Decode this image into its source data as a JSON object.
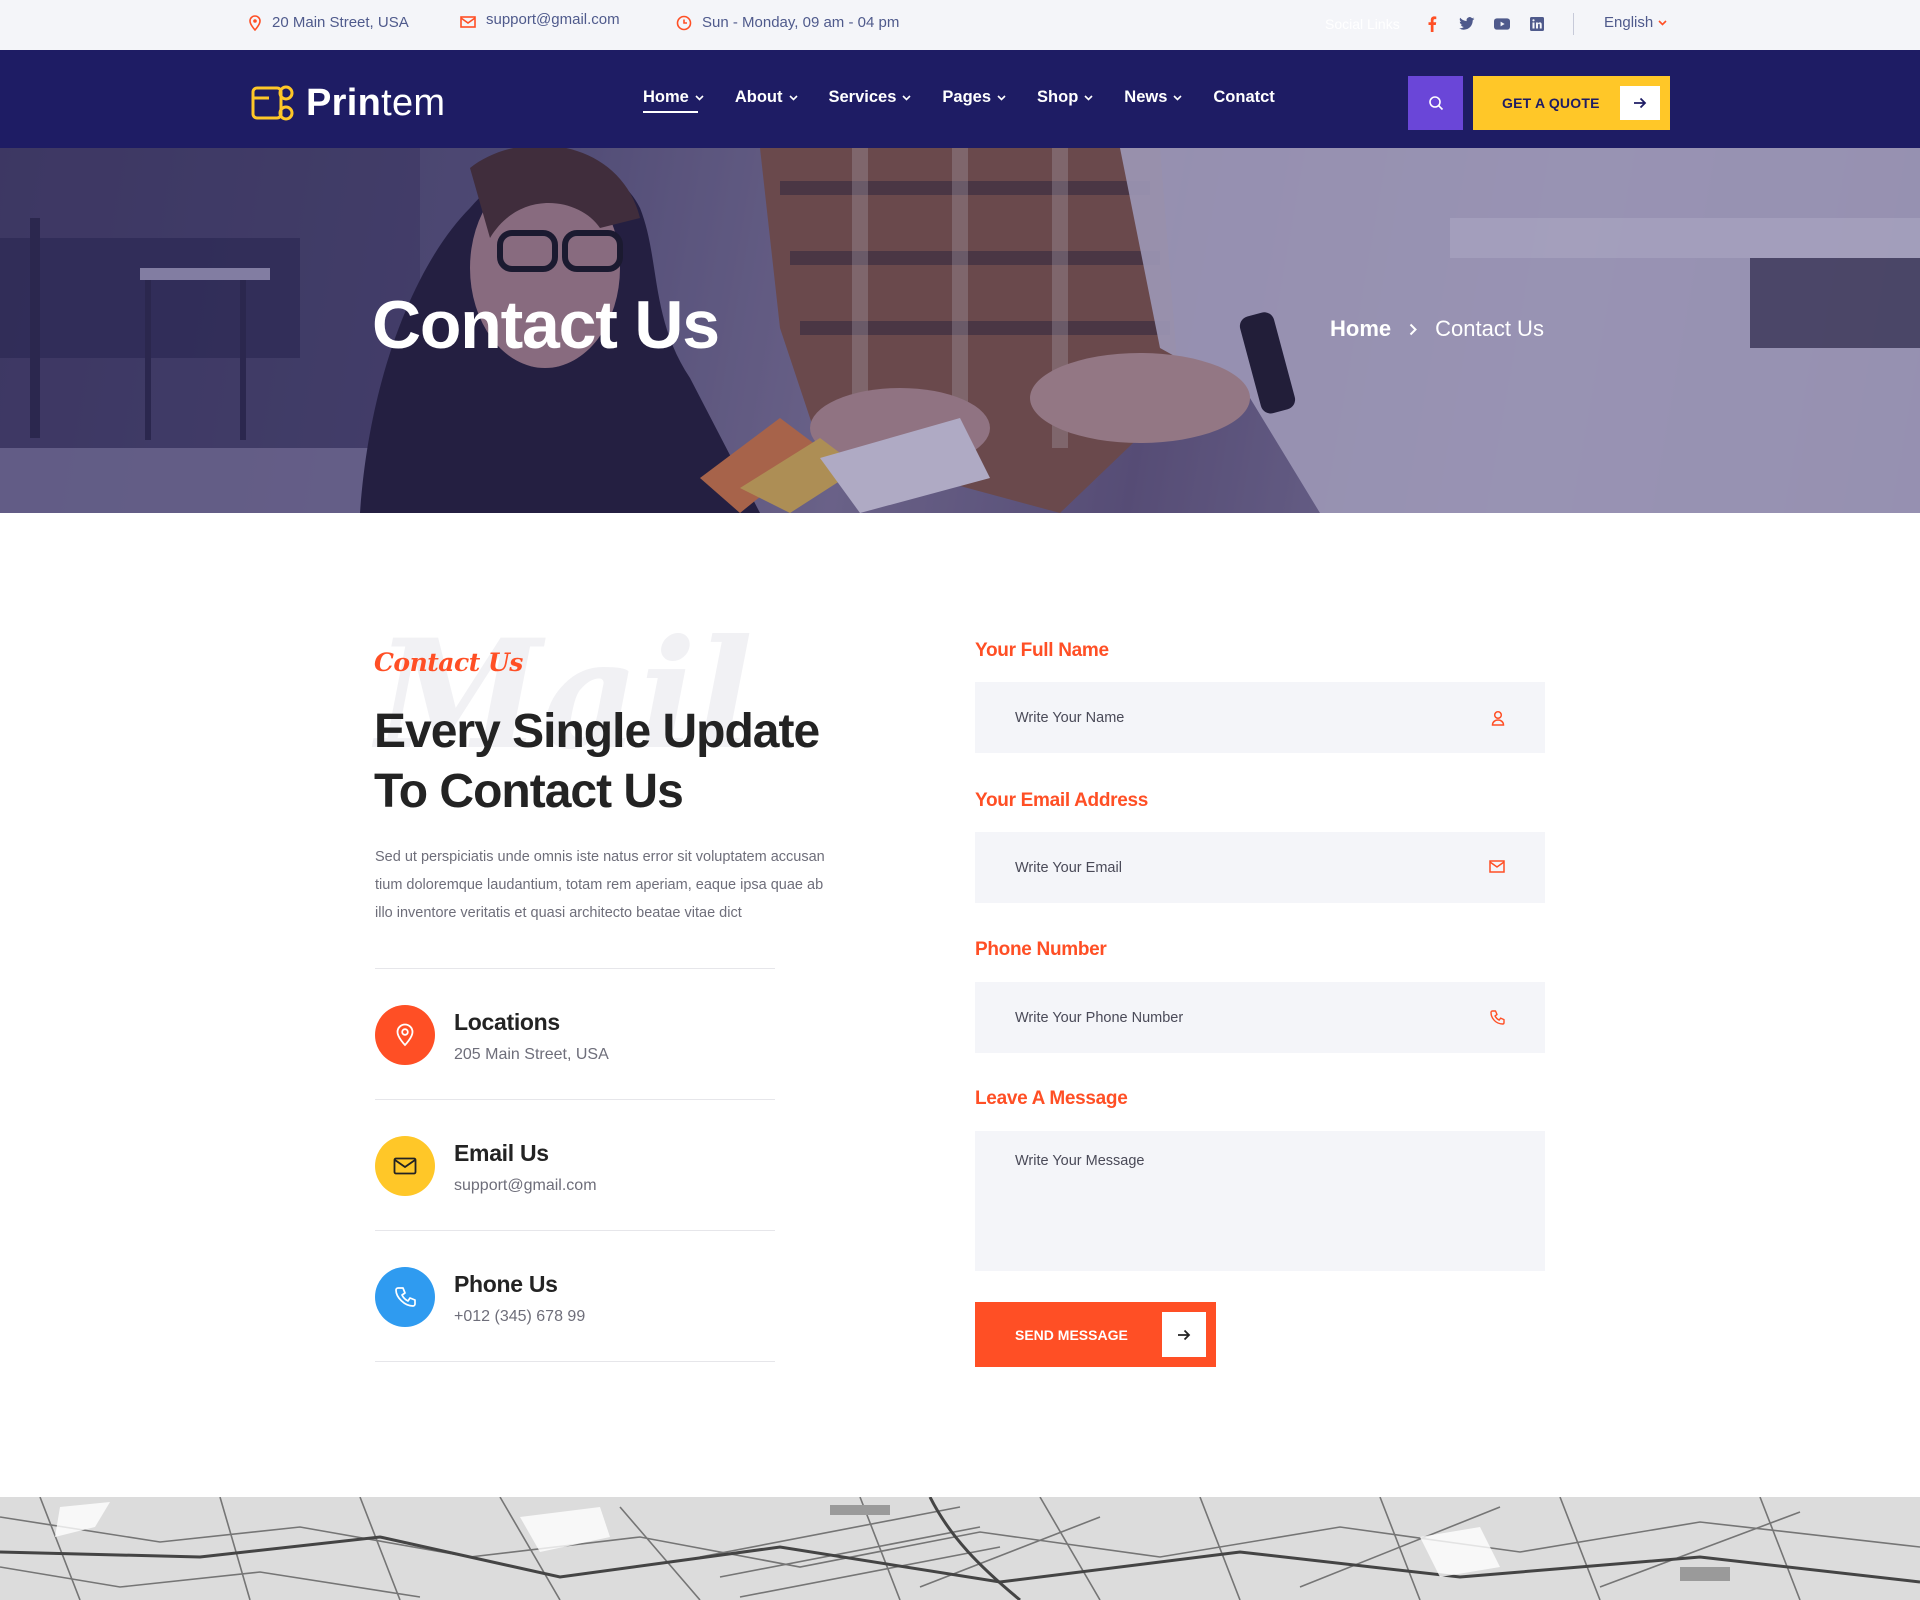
{
  "topbar": {
    "address": "20 Main Street, USA",
    "email": "support@gmail.com",
    "hours": "Sun - Monday, 09 am - 04 pm",
    "social_label": "Social Links",
    "social_icons": [
      "facebook-icon",
      "twitter-icon",
      "youtube-icon",
      "linkedin-icon"
    ],
    "language": "English"
  },
  "header": {
    "logo_bold": "Prin",
    "logo_light": "tem",
    "nav": [
      {
        "label": "Home",
        "active": true
      },
      {
        "label": "About"
      },
      {
        "label": "Services"
      },
      {
        "label": "Pages"
      },
      {
        "label": "Shop"
      },
      {
        "label": "News"
      },
      {
        "label": "Conatct"
      }
    ],
    "quote_label": "GET A QUOTE"
  },
  "hero": {
    "title": "Contact Us",
    "breadcrumb_home": "Home",
    "breadcrumb_current": "Contact Us"
  },
  "contact": {
    "bg_word": "Mail",
    "subtitle": "Contact Us",
    "title_line1": "Every Single Update",
    "title_line2": "To Contact Us",
    "description": "Sed ut perspiciatis unde omnis iste natus error sit voluptatem accusan tium doloremque laudantium, totam rem aperiam, eaque ipsa quae ab illo inventore veritatis et quasi architecto beatae vitae dict",
    "items": [
      {
        "title": "Locations",
        "value": "205 Main Street, USA",
        "icon": "location-pin-icon",
        "color": "#ff4f25"
      },
      {
        "title": "Email Us",
        "value": "support@gmail.com",
        "icon": "envelope-icon",
        "color": "#ffc728"
      },
      {
        "title": "Phone Us",
        "value": "+012 (345) 678 99",
        "icon": "phone-icon",
        "color": "#2f9bf0"
      }
    ]
  },
  "form": {
    "name_label": "Your Full Name",
    "name_placeholder": "Write Your Name",
    "email_label": "Your Email Address",
    "email_placeholder": "Write Your Email",
    "phone_label": "Phone Number",
    "phone_placeholder": "Write Your Phone Number",
    "message_label": "Leave A Message",
    "message_placeholder": "Write Your Message",
    "send_label": "SEND MESSAGE"
  },
  "colors": {
    "navy": "#1e1c64",
    "accent_orange": "#ff4f25",
    "accent_yellow": "#ffc728",
    "accent_purple": "#6a46d8",
    "accent_blue": "#2f9bf0"
  }
}
